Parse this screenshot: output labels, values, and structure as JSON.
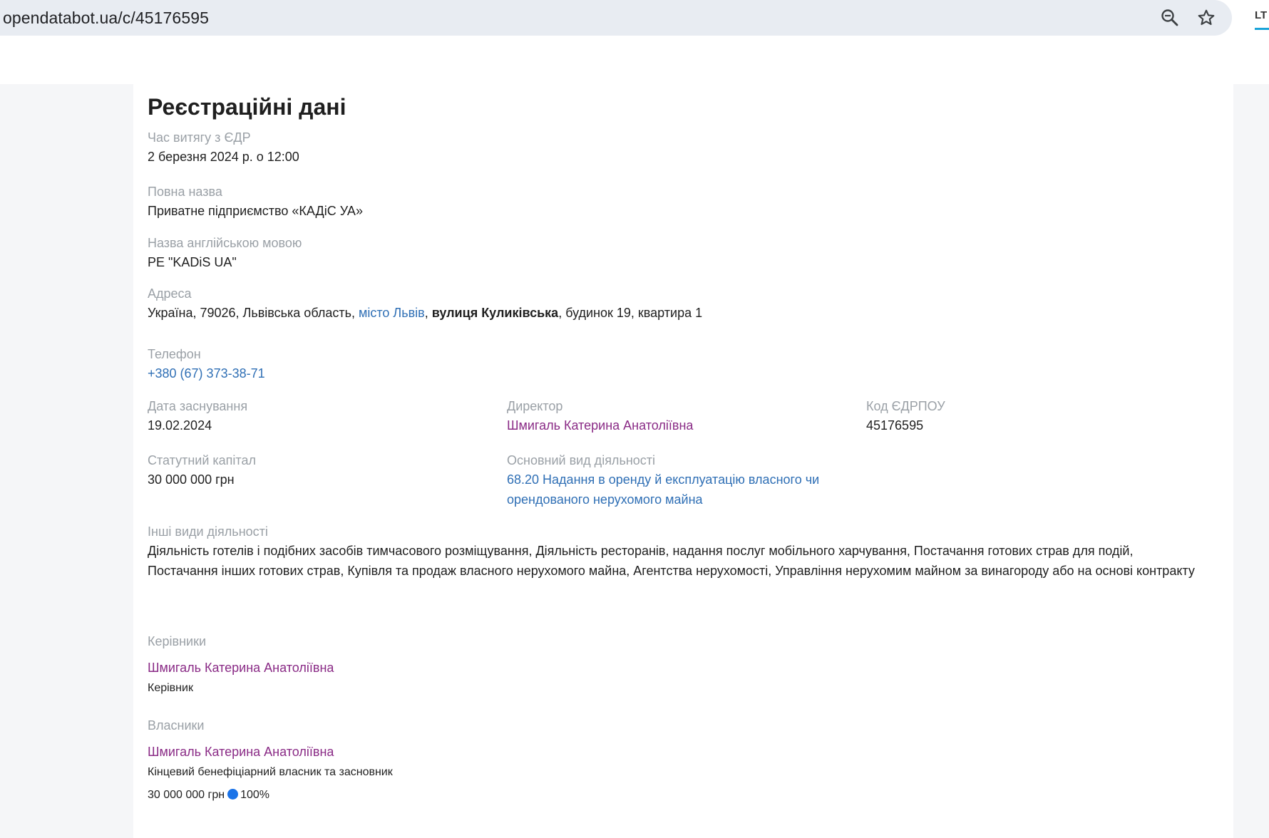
{
  "browser": {
    "url": "opendatabot.ua/c/45176595",
    "zoom_icon": "zoom-out-icon",
    "star_icon": "bookmark-star-icon",
    "extension_label": "LT"
  },
  "page": {
    "title": "Реєстраційні дані",
    "extract_time": {
      "label": "Час витягу з ЄДР",
      "value": "2 березня 2024 р. о 12:00"
    },
    "full_name": {
      "label": "Повна назва",
      "value": "Приватне підприємство «КАДіС УА»"
    },
    "english_name": {
      "label": "Назва англійською мовою",
      "value": "PE \"KADiS UA\""
    },
    "address": {
      "label": "Адреса",
      "part1": "Україна, 79026, Львівська область, ",
      "city": "місто Львів",
      "sep": ", ",
      "street": "вулиця Куликівська",
      "part2": ", будинок 19, квартира 1"
    },
    "phone": {
      "label": "Телефон",
      "value": "+380 (67) 373-38-71"
    },
    "founded": {
      "label": "Дата заснування",
      "value": "19.02.2024"
    },
    "director": {
      "label": "Директор",
      "value": "Шмигаль Катерина Анатоліївна"
    },
    "edrpou": {
      "label": "Код ЄДРПОУ",
      "value": "45176595"
    },
    "capital": {
      "label": "Статутний капітал",
      "value": "30 000 000 грн"
    },
    "main_activity": {
      "label": "Основний вид діяльності",
      "line1": "68.20 Надання в оренду й експлуатацію власного чи",
      "line2": "орендованого нерухомого майна"
    },
    "other_activities": {
      "label": "Інші види діяльності",
      "value": "Діяльність готелів і подібних засобів тимчасового розміщування, Діяльність ресторанів, надання послуг мобільного харчування, Постачання готових страв для подій, Постачання інших готових страв, Купівля та продаж власного нерухомого майна, Агентства нерухомості, Управління нерухомим майном за винагороду або на основі контракту"
    },
    "managers": {
      "label": "Керівники",
      "name": "Шмигаль Катерина Анатоліївна",
      "role": "Керівник"
    },
    "owners": {
      "label": "Власники",
      "name": "Шмигаль Катерина Анатоліївна",
      "role": "Кінцевий бенефіціарний власник та засновник",
      "amount": "30 000 000 грн",
      "share": "100%"
    }
  },
  "colors": {
    "link_blue": "#2f6fb5",
    "link_purple": "#8a2b86",
    "label_gray": "#9aa0a6",
    "share_dot": "#1a73e8"
  }
}
